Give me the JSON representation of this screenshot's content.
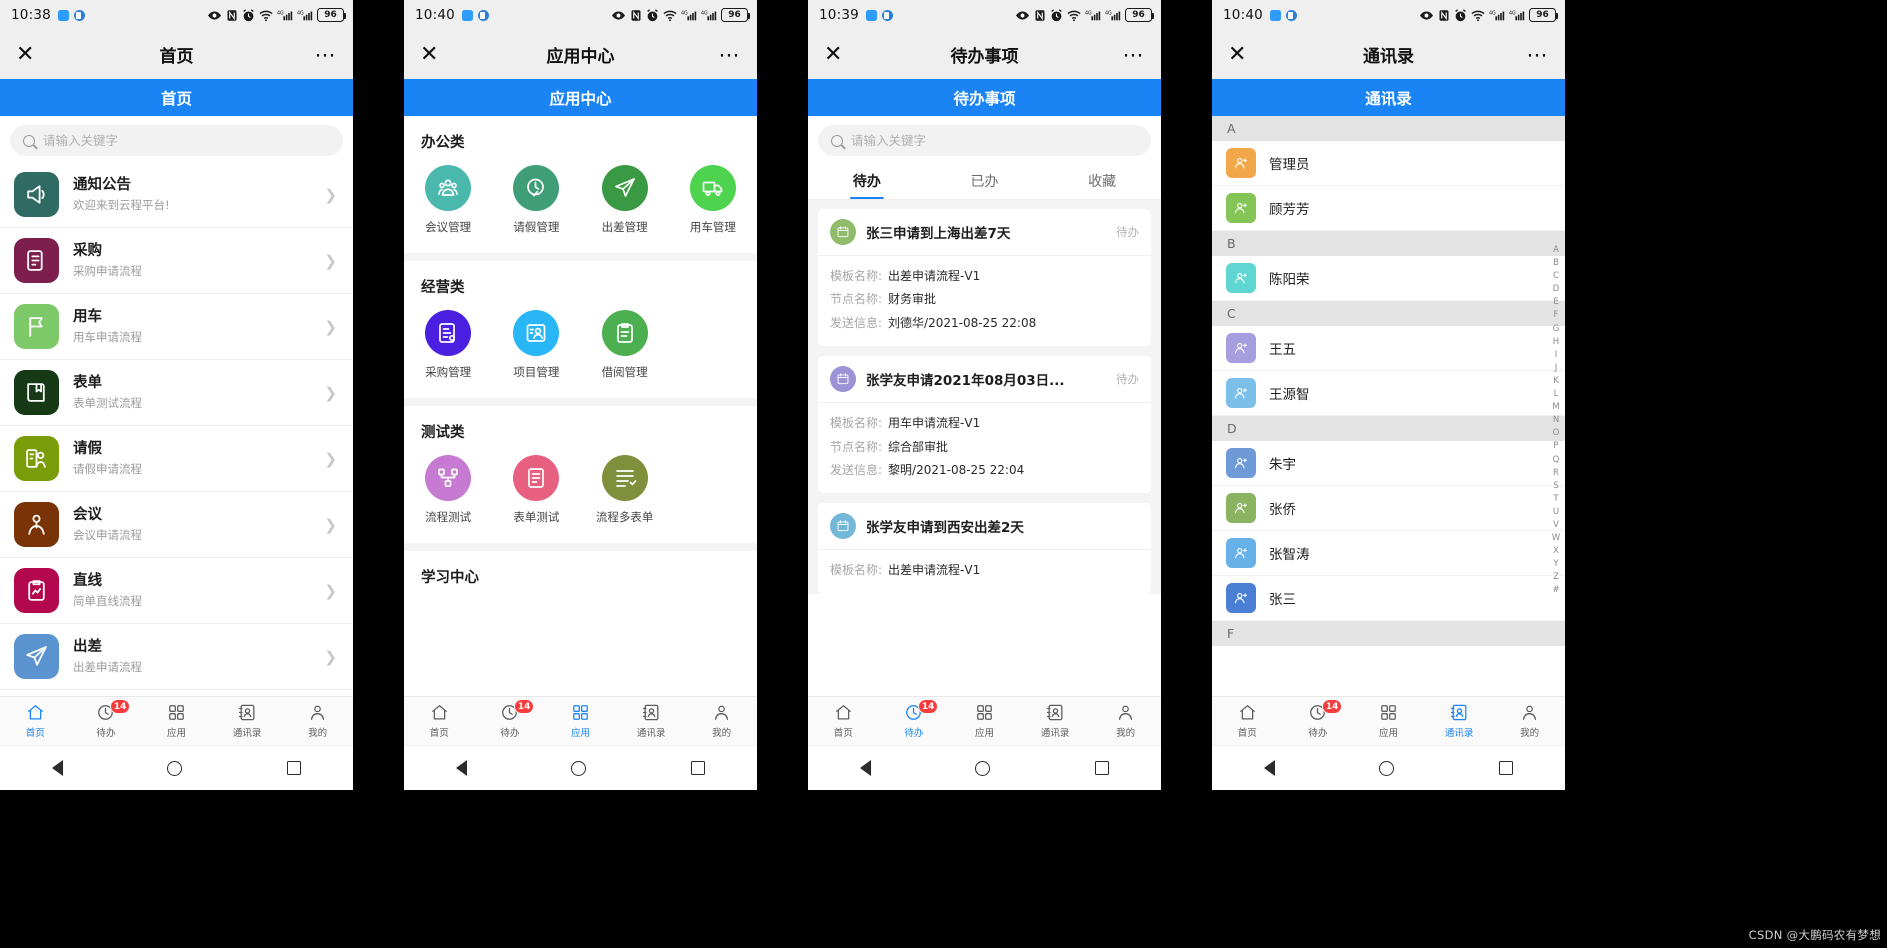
{
  "watermark": "CSDN @大鹏码农有梦想",
  "theme": {
    "accent": "#1a84f5",
    "badge_red": "#f63c3c",
    "statusbar_bg": "#efefef"
  },
  "panels": [
    {
      "id": "home",
      "status": {
        "time": "10:38",
        "battery": "96",
        "icons": [
          "eye-icon",
          "nfc-icon",
          "alarm-icon",
          "wifi-icon",
          "signal-4g-icon",
          "signal-icon"
        ]
      },
      "titlebar": {
        "close": "✕",
        "title": "首页",
        "more": "⋯"
      },
      "band": "首页",
      "search": {
        "placeholder": "请输入关键字",
        "value": ""
      },
      "list": [
        {
          "title": "通知公告",
          "sub": "欢迎来到云程平台!",
          "color": "#2f6b62",
          "icon": "megaphone-icon"
        },
        {
          "title": "采购",
          "sub": "采购申请流程",
          "color": "#7e1e4d",
          "icon": "document-edit-icon"
        },
        {
          "title": "用车",
          "sub": "用车申请流程",
          "color": "#7dc96a",
          "icon": "flag-icon"
        },
        {
          "title": "表单",
          "sub": "表单测试流程",
          "color": "#163a15",
          "icon": "book-icon"
        },
        {
          "title": "请假",
          "sub": "请假申请流程",
          "color": "#7a9c09",
          "icon": "person-document-icon"
        },
        {
          "title": "会议",
          "sub": "会议申请流程",
          "color": "#7a3207",
          "icon": "person-tie-icon"
        },
        {
          "title": "直线",
          "sub": "简单直线流程",
          "color": "#b3084d",
          "icon": "clipboard-chart-icon"
        },
        {
          "title": "出差",
          "sub": "出差申请流程",
          "color": "#5a93cf",
          "icon": "paper-plane-icon"
        }
      ],
      "tabs": [
        {
          "label": "首页",
          "icon": "home-icon",
          "active": true,
          "badge": ""
        },
        {
          "label": "待办",
          "icon": "clock-icon",
          "active": false,
          "badge": "14"
        },
        {
          "label": "应用",
          "icon": "grid-icon",
          "active": false,
          "badge": ""
        },
        {
          "label": "通讯录",
          "icon": "contacts-icon",
          "active": false,
          "badge": ""
        },
        {
          "label": "我的",
          "icon": "person-icon",
          "active": false,
          "badge": ""
        }
      ]
    },
    {
      "id": "appcenter",
      "status": {
        "time": "10:40",
        "battery": "96"
      },
      "titlebar": {
        "close": "✕",
        "title": "应用中心",
        "more": "⋯"
      },
      "band": "应用中心",
      "sections": [
        {
          "title": "办公类",
          "apps": [
            {
              "label": "会议管理",
              "color": "#4bb8ae",
              "icon": "meeting-icon"
            },
            {
              "label": "请假管理",
              "color": "#3f9e78",
              "icon": "clock-check-icon"
            },
            {
              "label": "出差管理",
              "color": "#3a9943",
              "icon": "send-icon"
            },
            {
              "label": "用车管理",
              "color": "#4ed34e",
              "icon": "truck-icon"
            }
          ]
        },
        {
          "title": "经营类",
          "apps": [
            {
              "label": "采购管理",
              "color": "#4b1fe0",
              "icon": "form-icon"
            },
            {
              "label": "项目管理",
              "color": "#29b6f6",
              "icon": "user-board-icon"
            },
            {
              "label": "借阅管理",
              "color": "#4caf50",
              "icon": "clipboard-icon"
            }
          ]
        },
        {
          "title": "测试类",
          "apps": [
            {
              "label": "流程测试",
              "color": "#c77ad1",
              "icon": "flow-icon"
            },
            {
              "label": "表单测试",
              "color": "#e8607f",
              "icon": "form-test-icon"
            },
            {
              "label": "流程多表单",
              "color": "#7f8f3c",
              "icon": "multi-form-icon"
            }
          ]
        },
        {
          "title": "学习中心",
          "apps": []
        }
      ],
      "tabs": [
        {
          "label": "首页",
          "icon": "home-icon",
          "active": false,
          "badge": ""
        },
        {
          "label": "待办",
          "icon": "clock-icon",
          "active": false,
          "badge": "14"
        },
        {
          "label": "应用",
          "icon": "grid-icon",
          "active": true,
          "badge": ""
        },
        {
          "label": "通讯录",
          "icon": "contacts-icon",
          "active": false,
          "badge": ""
        },
        {
          "label": "我的",
          "icon": "person-icon",
          "active": false,
          "badge": ""
        }
      ]
    },
    {
      "id": "todo",
      "status": {
        "time": "10:39",
        "battery": "96"
      },
      "titlebar": {
        "close": "✕",
        "title": "待办事项",
        "more": "⋯"
      },
      "band": "待办事项",
      "search": {
        "placeholder": "请输入关键字",
        "value": ""
      },
      "tabs_inner": [
        {
          "label": "待办",
          "active": true
        },
        {
          "label": "已办",
          "active": false
        },
        {
          "label": "收藏",
          "active": false
        }
      ],
      "labels": {
        "template": "模板名称:",
        "node": "节点名称:",
        "sender": "发送信息:"
      },
      "cards": [
        {
          "title": "张三申请到上海出差7天",
          "state": "待办",
          "icon_color": "#8fbb6b",
          "template": "出差申请流程-V1",
          "node": "财务审批",
          "sender": "刘德华/2021-08-25 22:08"
        },
        {
          "title": "张学友申请2021年08月03日...",
          "state": "待办",
          "icon_color": "#9b93d6",
          "template": "用车申请流程-V1",
          "node": "综合部审批",
          "sender": "黎明/2021-08-25 22:04"
        },
        {
          "title": "张学友申请到西安出差2天",
          "state": "",
          "icon_color": "#74b8d8",
          "template": "出差申请流程-V1",
          "node": "",
          "sender": ""
        }
      ],
      "tabs": [
        {
          "label": "首页",
          "icon": "home-icon",
          "active": false,
          "badge": ""
        },
        {
          "label": "待办",
          "icon": "clock-icon",
          "active": true,
          "badge": "14"
        },
        {
          "label": "应用",
          "icon": "grid-icon",
          "active": false,
          "badge": ""
        },
        {
          "label": "通讯录",
          "icon": "contacts-icon",
          "active": false,
          "badge": ""
        },
        {
          "label": "我的",
          "icon": "person-icon",
          "active": false,
          "badge": ""
        }
      ]
    },
    {
      "id": "contacts",
      "status": {
        "time": "10:40",
        "battery": "96"
      },
      "titlebar": {
        "close": "✕",
        "title": "通讯录",
        "more": "⋯"
      },
      "band": "通讯录",
      "index_letters": [
        "A",
        "B",
        "C",
        "D",
        "E",
        "F",
        "G",
        "H",
        "I",
        "J",
        "K",
        "L",
        "M",
        "N",
        "O",
        "P",
        "Q",
        "R",
        "S",
        "T",
        "U",
        "V",
        "W",
        "X",
        "Y",
        "Z",
        "#"
      ],
      "groups": [
        {
          "letter": "A",
          "people": [
            {
              "name": "管理员",
              "color": "#f5a councils"
            }
          ]
        }
      ],
      "groups_flat": [
        {
          "type": "header",
          "letter": "A"
        },
        {
          "type": "person",
          "name": "管理员",
          "color": "#f2a74b"
        },
        {
          "type": "person",
          "name": "顾芳芳",
          "color": "#85c457"
        },
        {
          "type": "header",
          "letter": "B"
        },
        {
          "type": "person",
          "name": "陈阳荣",
          "color": "#5fd6d1"
        },
        {
          "type": "header",
          "letter": "C"
        },
        {
          "type": "person",
          "name": "王五",
          "color": "#a79ee0"
        },
        {
          "type": "person",
          "name": "王源智",
          "color": "#7cc0ea"
        },
        {
          "type": "header",
          "letter": "D"
        },
        {
          "type": "person",
          "name": "朱宇",
          "color": "#6e9bd8"
        },
        {
          "type": "person",
          "name": "张侨",
          "color": "#8bb362"
        },
        {
          "type": "person",
          "name": "张智涛",
          "color": "#67b1e8"
        },
        {
          "type": "person",
          "name": "张三",
          "color": "#4a7fd4"
        },
        {
          "type": "header",
          "letter": "F"
        }
      ],
      "tabs": [
        {
          "label": "首页",
          "icon": "home-icon",
          "active": false,
          "badge": ""
        },
        {
          "label": "待办",
          "icon": "clock-icon",
          "active": false,
          "badge": "14"
        },
        {
          "label": "应用",
          "icon": "grid-icon",
          "active": false,
          "badge": ""
        },
        {
          "label": "通讯录",
          "icon": "contacts-icon",
          "active": true,
          "badge": ""
        },
        {
          "label": "我的",
          "icon": "person-icon",
          "active": false,
          "badge": ""
        }
      ]
    }
  ]
}
